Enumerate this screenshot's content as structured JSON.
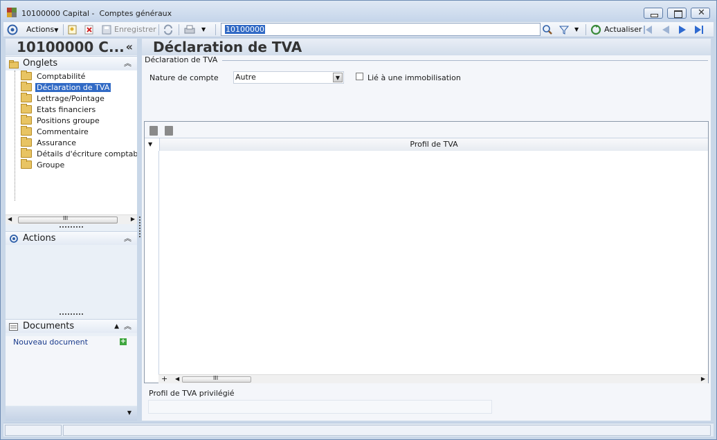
{
  "window": {
    "title": "10100000 Capital -  Comptes généraux"
  },
  "toolbar": {
    "actions_label": "Actions",
    "save_label": "Enregistrer",
    "search_value": "10100000",
    "refresh_label": "Actualiser"
  },
  "left_panel": {
    "title": "10100000 C...",
    "collapse_glyph": "«",
    "onglets_label": "Onglets",
    "tabs": [
      {
        "label": "Comptabilité"
      },
      {
        "label": "Déclaration de TVA"
      },
      {
        "label": "Lettrage/Pointage"
      },
      {
        "label": "Etats financiers"
      },
      {
        "label": "Positions groupe"
      },
      {
        "label": "Commentaire"
      },
      {
        "label": "Assurance"
      },
      {
        "label": "Détails d'écriture comptable"
      },
      {
        "label": "Groupe"
      }
    ],
    "selected_tab": 1,
    "scroll_thumb_glyph": "III",
    "actions_label": "Actions",
    "documents_label": "Documents",
    "new_document_label": "Nouveau document"
  },
  "main": {
    "page_title": "Déclaration de TVA",
    "group_label": "Déclaration de TVA",
    "nature_label": "Nature de compte",
    "nature_value": "Autre",
    "linked_asset_label": "Lié à une immobilisation",
    "linked_asset_checked": false,
    "grid": {
      "columns": [
        "Profil de TVA"
      ],
      "rows": []
    },
    "grid_scroll_thumb_glyph": "III",
    "preferred_profile_label": "Profil de TVA privilégié",
    "preferred_profile_value": ""
  }
}
